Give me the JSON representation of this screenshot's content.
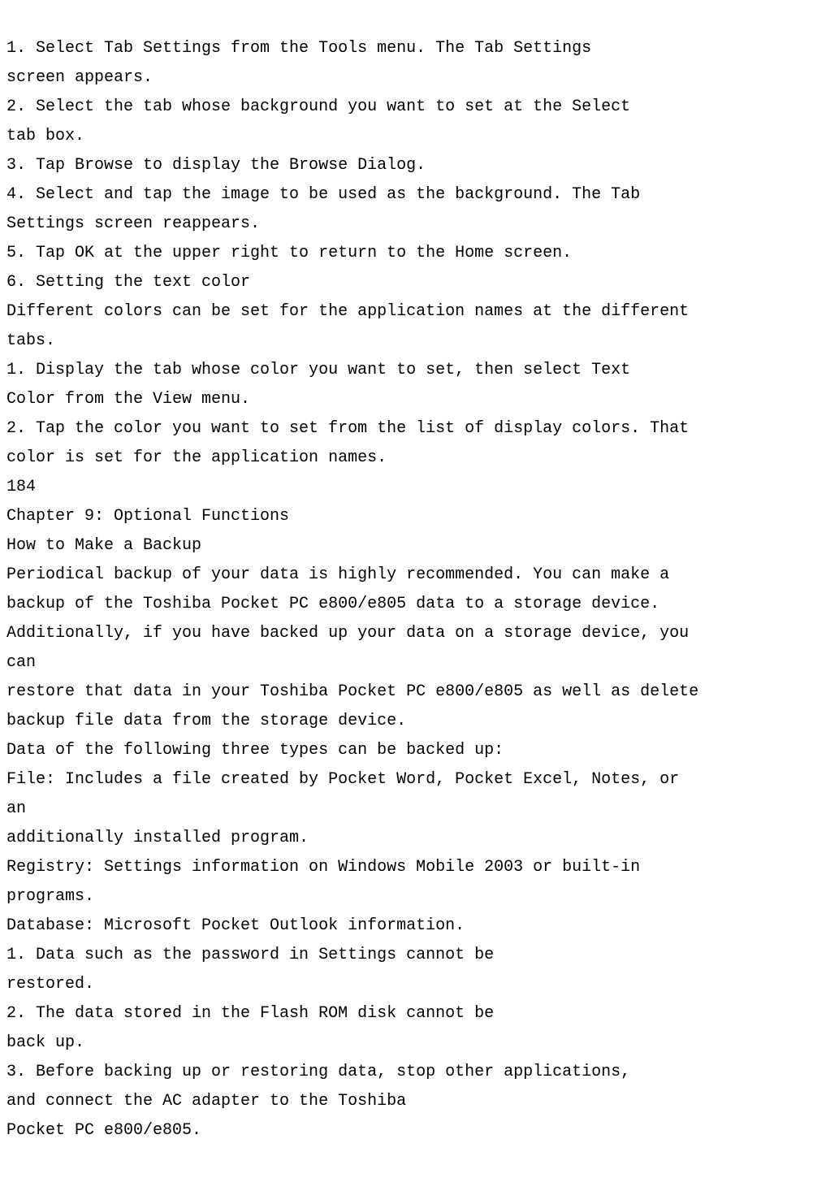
{
  "doc": {
    "lines": [
      "1. Select Tab Settings from the Tools menu. The Tab Settings",
      "screen appears.",
      "2. Select the tab whose background you want to set at the Select",
      "tab box.",
      "3. Tap Browse to display the Browse Dialog.",
      "4. Select and tap the image to be used as the background. The Tab",
      "Settings screen reappears.",
      "5. Tap OK at the upper right to return to the Home screen.",
      "6. Setting the text color",
      "Different colors can be set for the application names at the different",
      "tabs.",
      "1. Display the tab whose color you want to set, then select Text",
      "Color from the View menu.",
      "2. Tap the color you want to set from the list of display colors. That",
      "color is set for the application names.",
      "184",
      "Chapter 9: Optional Functions",
      "How to Make a Backup",
      "Periodical backup of your data is highly recommended. You can make a",
      "backup of the Toshiba Pocket PC e800/e805 data to a storage device.",
      "Additionally, if you have backed up your data on a storage device, you",
      "can",
      "restore that data in your Toshiba Pocket PC e800/e805 as well as delete",
      "backup file data from the storage device.",
      "Data of the following three types can be backed up:",
      "File: Includes a file created by Pocket Word, Pocket Excel, Notes, or",
      "an",
      "additionally installed program.",
      "Registry: Settings information on Windows Mobile 2003 or built-in",
      "programs.",
      "Database: Microsoft Pocket Outlook information.",
      "1. Data such as the password in Settings cannot be",
      "restored.",
      "2. The data stored in the Flash ROM disk cannot be",
      "back up.",
      "3. Before backing up or restoring data, stop other applications,",
      "and connect the AC adapter to the Toshiba",
      "Pocket PC e800/e805."
    ]
  }
}
